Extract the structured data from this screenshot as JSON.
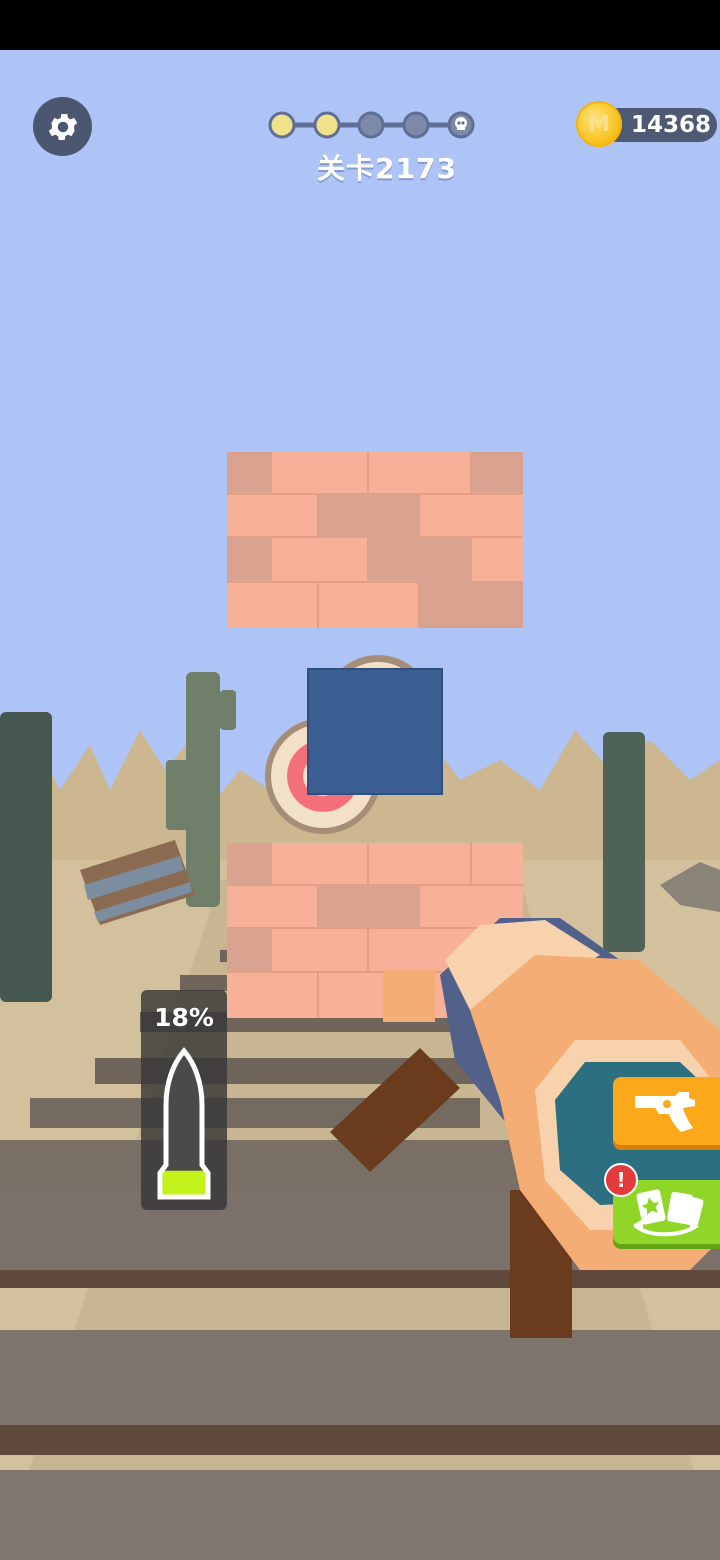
{
  "hud": {
    "level_label": "关卡2173",
    "coins": "14368",
    "coin_symbol": "M",
    "stage_progress": {
      "total": 5,
      "completed": 2,
      "final_stage_icon": "skull-icon"
    },
    "settings_icon": "gear-icon"
  },
  "ammo": {
    "percent_label": "18%",
    "fill_fraction": 0.18
  },
  "side_buttons": {
    "weapon_icon": "revolver-icon",
    "cards_icon": "cards-swap-icon",
    "cards_alert": "!"
  },
  "colors": {
    "sky": "#aec4f7",
    "brick": "#f7b199",
    "blue_block": "#3b5f93",
    "weapon_button": "#fba91b",
    "cards_button": "#8fd629",
    "ammo_fill": "#c2f21a",
    "coin": "#f7c21f"
  }
}
